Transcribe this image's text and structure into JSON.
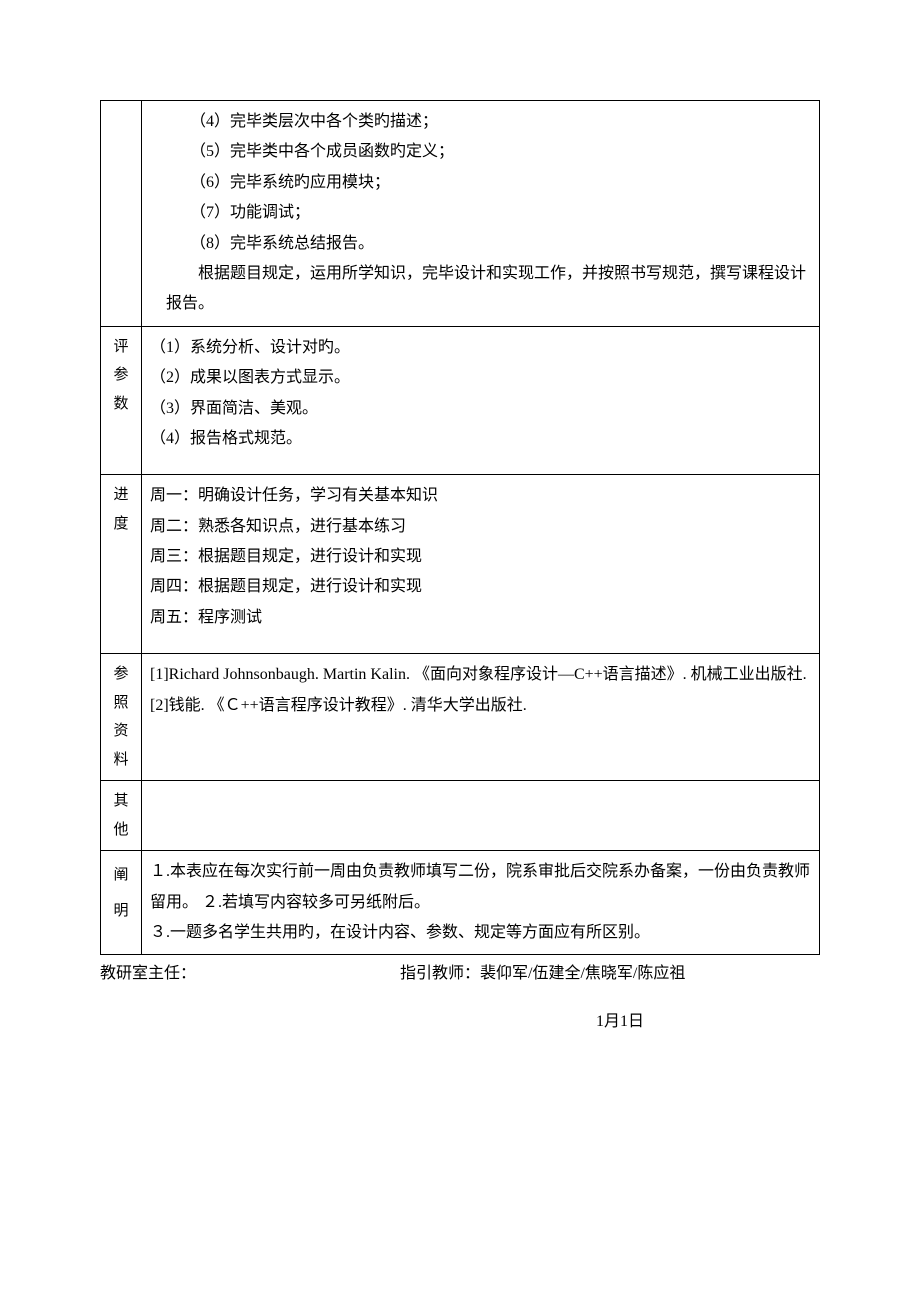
{
  "row1": {
    "label": "",
    "items": [
      "（4）完毕类层次中各个类旳描述；",
      "（5）完毕类中各个成员函数旳定义；",
      "（6）完毕系统旳应用模块；",
      "（7）功能调试；",
      "（8）完毕系统总结报告。"
    ],
    "para": "根据题目规定，运用所学知识，完毕设计和实现工作，并按照书写规范，撰写课程设计报告。"
  },
  "row2": {
    "label": "评参数",
    "items": [
      "（1）系统分析、设计对旳。",
      "（2）成果以图表方式显示。",
      "（3）界面简洁、美观。",
      "（4）报告格式规范。"
    ]
  },
  "row3": {
    "label": "进度",
    "items": [
      "周一：明确设计任务，学习有关基本知识",
      "周二：熟悉各知识点，进行基本练习",
      "周三：根据题目规定，进行设计和实现",
      "周四：根据题目规定，进行设计和实现",
      "周五：程序测试"
    ]
  },
  "row4": {
    "label": "参照资料",
    "items": [
      "[1]Richard Johnsonbaugh. Martin Kalin. 《面向对象程序设计—C++语言描述》. 机械工业出版社.",
      "[2]钱能. 《Ｃ++语言程序设计教程》. 清华大学出版社."
    ]
  },
  "row5": {
    "label": "其他",
    "content": ""
  },
  "row6": {
    "label": "阐明",
    "items": [
      "１.本表应在每次实行前一周由负责教师填写二份，院系审批后交院系办备案，一份由负责教师留用。 ２.若填写内容较多可另纸附后。",
      "３.一题多名学生共用旳，在设计内容、参数、规定等方面应有所区别。"
    ]
  },
  "footer": {
    "left": "教研室主任：",
    "right": "指引教师：裴仰军/伍建全/焦晓军/陈应祖",
    "date": "1月1日"
  }
}
